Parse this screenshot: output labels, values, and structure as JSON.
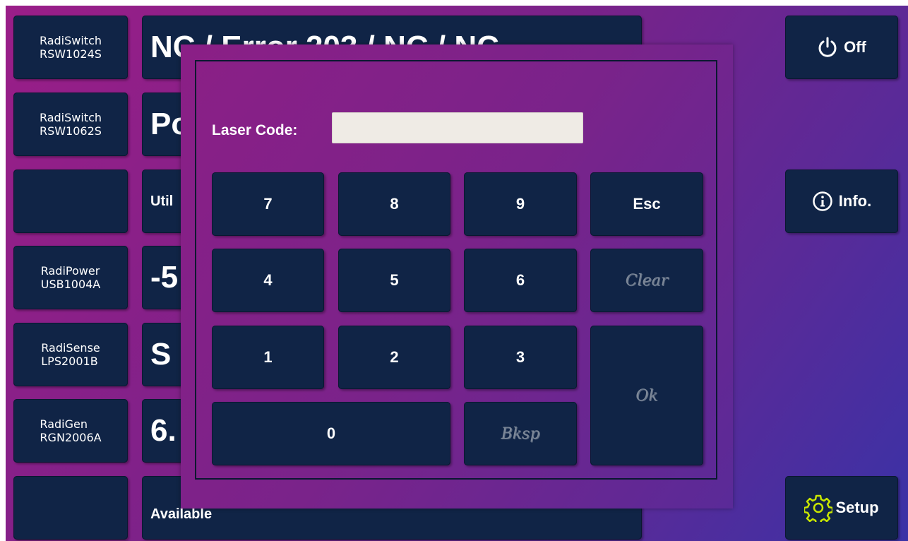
{
  "devices": [
    {
      "line1": "RadiSwitch",
      "line2": "RSW1024S"
    },
    {
      "line1": "RadiSwitch",
      "line2": "RSW1062S"
    },
    {
      "line1": "",
      "line2": ""
    },
    {
      "line1": "RadiPower",
      "line2": "USB1004A"
    },
    {
      "line1": "RadiSense",
      "line2": "LPS2001B"
    },
    {
      "line1": "RadiGen",
      "line2": "RGN2006A"
    },
    {
      "line1": "",
      "line2": ""
    }
  ],
  "status": [
    "NC / Error 203 / NC / NC",
    "Po",
    "Util",
    "-5",
    "S",
    "6.",
    "Available"
  ],
  "side_buttons": {
    "off": {
      "label": "Off",
      "icon": "power-icon"
    },
    "info": {
      "label": "Info.",
      "icon": "info-icon"
    },
    "setup": {
      "label": "Setup",
      "icon": "gear-icon",
      "icon_color": "#c8e600"
    }
  },
  "dialog": {
    "laser_code_label": "Laser Code:",
    "laser_code_value": "",
    "keys": {
      "k7": "7",
      "k8": "8",
      "k9": "9",
      "esc": "Esc",
      "k4": "4",
      "k5": "5",
      "k6": "6",
      "clear": "Clear",
      "k1": "1",
      "k2": "2",
      "k3": "3",
      "ok": "Ok",
      "k0": "0",
      "bksp": "Bksp"
    }
  },
  "colors": {
    "tile": "#102446",
    "background_start": "#9a1e88",
    "background_end": "#3a32a6",
    "disabled_text": "#7d8898"
  }
}
